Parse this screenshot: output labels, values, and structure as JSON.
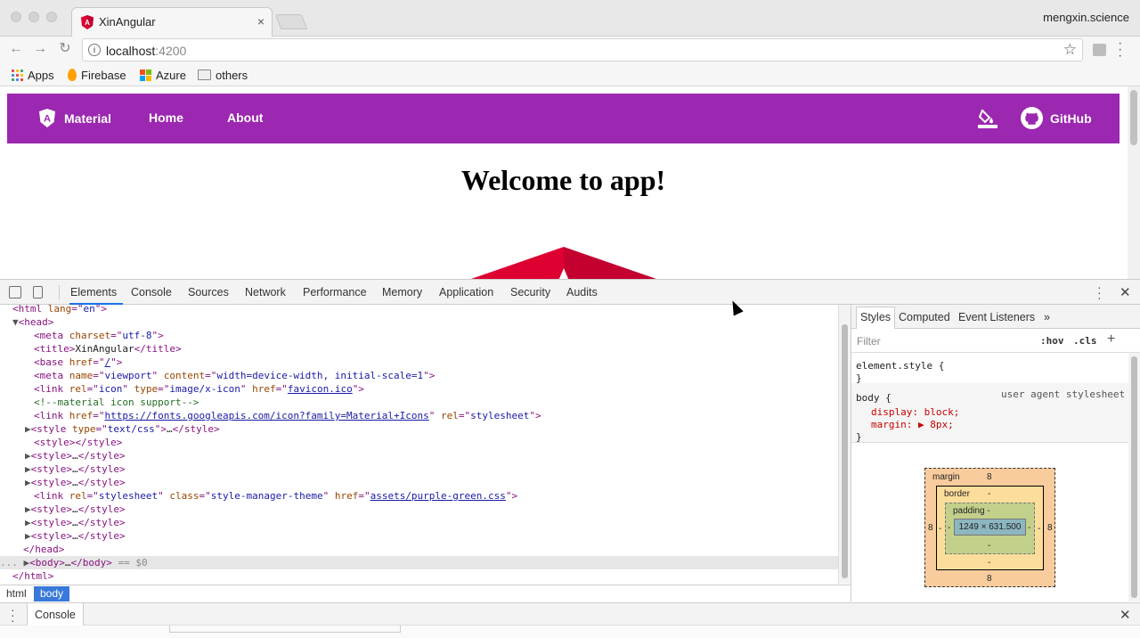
{
  "browser": {
    "tab_title": "XinAngular",
    "tab_close": "×",
    "profile_name": "mengxin.science",
    "url_host": "localhost",
    "url_port": ":4200",
    "bookmarks": [
      "Apps",
      "Firebase",
      "Azure",
      "others"
    ]
  },
  "app": {
    "brand": "Material",
    "nav": [
      "Home",
      "About"
    ],
    "github_label": "GitHub",
    "welcome": "Welcome to app!",
    "toolbar_color": "#9c27b0"
  },
  "devtools": {
    "tabs": [
      "Elements",
      "Console",
      "Sources",
      "Network",
      "Performance",
      "Memory",
      "Application",
      "Security",
      "Audits"
    ],
    "active_tab": "Elements",
    "dom_lines": [
      "<html lang=\"en\">",
      "<head>",
      "<meta charset=\"utf-8\">",
      "<title>XinAngular</title>",
      "<base href=\"/\">",
      "<meta name=\"viewport\" content=\"width=device-width, initial-scale=1\">",
      "<link rel=\"icon\" type=\"image/x-icon\" href=\"favicon.ico\">",
      "<!--material icon support-->",
      "<link href=\"https://fonts.googleapis.com/icon?family=Material+Icons\" rel=\"stylesheet\">",
      "<style type=\"text/css\">…</style>",
      "<style></style>",
      "<style>…</style>",
      "<style>…</style>",
      "<style>…</style>",
      "<link rel=\"stylesheet\" class=\"style-manager-theme\" href=\"assets/purple-green.css\">",
      "<style>…</style>",
      "<style>…</style>",
      "<style>…</style>",
      "</head>",
      "<body>…</body> == $0",
      "</html>"
    ],
    "breadcrumbs": [
      "html",
      "body"
    ],
    "side_tabs": [
      "Styles",
      "Computed",
      "Event Listeners"
    ],
    "side_more": "»",
    "filter_placeholder": "Filter",
    "hov": ":hov",
    "cls": ".cls",
    "element_style": "element.style {\n}",
    "body_rule_selector": "body {",
    "body_rule_source": "user agent stylesheet",
    "body_rule_display": "display: block;",
    "body_rule_margin": "margin: ▶ 8px;",
    "body_rule_close": "}",
    "box_model": {
      "margin_label": "margin",
      "margin_top": "8",
      "margin_bottom": "8",
      "margin_left": "8",
      "margin_right": "8",
      "border_label": "border",
      "border_top": "-",
      "border_bottom": "-",
      "border_left": "-",
      "border_right": "-",
      "padding_label": "padding -",
      "padding_bottom": "-",
      "padding_left": "-",
      "padding_right": "-",
      "content": "1249 × 631.500"
    },
    "drawer_tab": "Console"
  }
}
